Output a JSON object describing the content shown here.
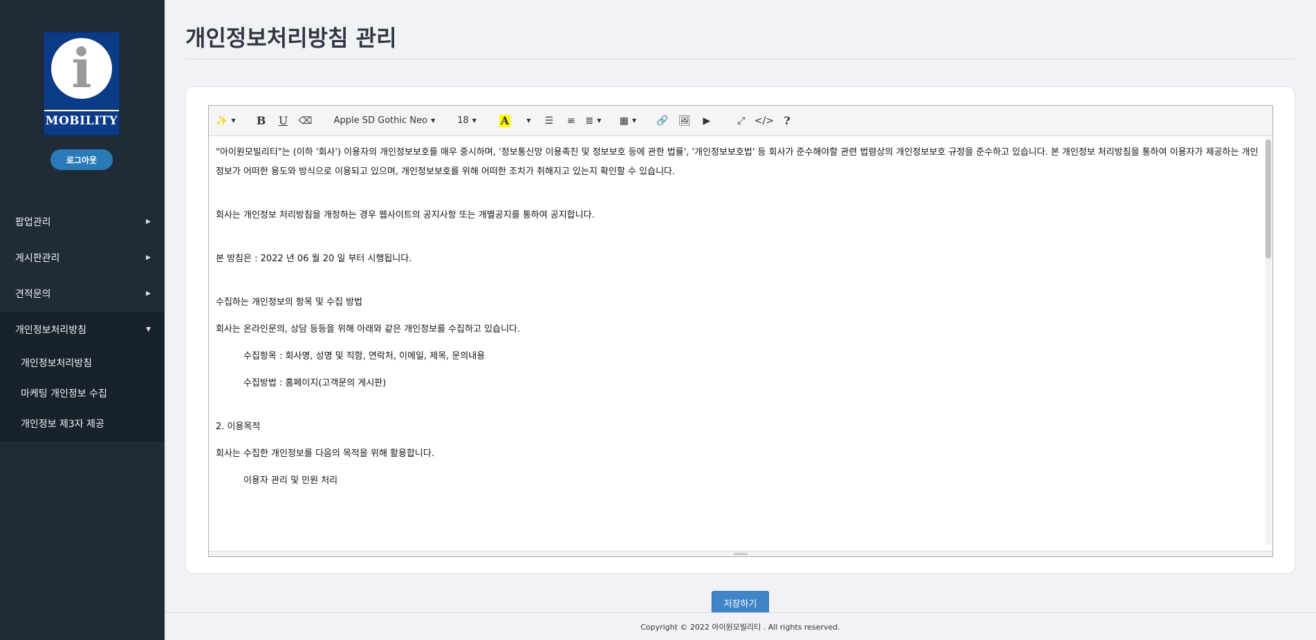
{
  "sidebar": {
    "logo_text": "MOBILITY",
    "logout_label": "로그아웃",
    "menu": [
      {
        "label": "팝업관리"
      },
      {
        "label": "게시판관리"
      },
      {
        "label": "견적문의"
      },
      {
        "label": "개인정보처리방침"
      }
    ],
    "submenu": [
      {
        "label": "개인정보처리방침"
      },
      {
        "label": "마케팅 개인정보 수집"
      },
      {
        "label": "개인정보 제3자 제공"
      }
    ]
  },
  "header": {
    "title": "개인정보처리방침 관리"
  },
  "toolbar": {
    "font_name": "Apple SD Gothic Neo",
    "font_size": "18",
    "bold": "B",
    "underline": "U",
    "color_glyph": "A",
    "help": "?"
  },
  "content": {
    "para1": "\"아이원모빌리티\"는 (이하 '회사') 이용자의 개인정보보호를 매우 중시하며, '정보통신망 이용촉진 및 정보보호 등에 관한 법률', '개인정보보호법' 등 회사가 준수해야할 관련 법령상의 개인정보보호 규정을 준수하고 있습니다. 본 개인정보 처리방침을 통하여 이용자가 제공하는 개인정보가 어떠한 용도와 방식으로 이용되고 있으며, 개인정보보호를 위해 어떠한 조치가 취해지고 있는지 확인할 수 있습니다.",
    "para2": "회사는 개인정보 처리방침을 개정하는 경우 웹사이트의 공지사항 또는 개별공지를 통하여 공지합니다.",
    "para3": "본 방침은 : 2022 년 06 월 20 일 부터 시행됩니다.",
    "para4": "수집하는 개인정보의 항목 및 수집 방법",
    "para5": "회사는 온라인문의, 상담 등등을 위해 아래와 같은 개인정보를 수집하고 있습니다.",
    "para6": "수집항목 : 회사명, 성명 및 직함, 연락처, 이메일, 제목, 문의내용",
    "para7": "수집방법 : 홈페이지(고객문의 게시판)",
    "para8": "2. 이용목적",
    "para9": "회사는 수집한 개인정보를 다음의 목적을 위해 활용합니다.",
    "para10": "이용자 관리 및 민원 처리"
  },
  "save_label": "저장하기",
  "footer": {
    "copyright": "Copyright © 2022 아이원모빌리티 . All rights reserved."
  }
}
